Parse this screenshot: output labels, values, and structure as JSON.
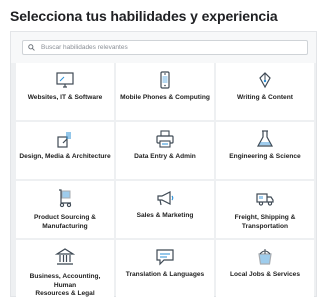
{
  "header": {
    "title": "Selecciona tus habilidades y experiencia"
  },
  "search": {
    "placeholder": "Buscar habilidades relevantes"
  },
  "categories": [
    {
      "label": "Websites, IT & Software",
      "icon": "monitor-icon"
    },
    {
      "label": "Mobile Phones & Computing",
      "icon": "mobile-phone-icon"
    },
    {
      "label": "Writing & Content",
      "icon": "pen-nib-icon"
    },
    {
      "label": "Design, Media & Architecture",
      "icon": "paint-palette-icon"
    },
    {
      "label": "Data Entry & Admin",
      "icon": "printer-icon"
    },
    {
      "label": "Engineering & Science",
      "icon": "flask-icon"
    },
    {
      "label": "Product Sourcing &\nManufacturing",
      "icon": "hand-truck-icon"
    },
    {
      "label": "Sales & Marketing",
      "icon": "megaphone-icon"
    },
    {
      "label": "Freight, Shipping &\nTransportation",
      "icon": "delivery-truck-icon"
    },
    {
      "label": "Business, Accounting, Human\nResources & Legal",
      "icon": "bank-building-icon"
    },
    {
      "label": "Translation & Languages",
      "icon": "speech-bubble-icon"
    },
    {
      "label": "Local Jobs & Services",
      "icon": "paint-bucket-icon"
    }
  ],
  "colors": {
    "icon_stroke": "#3f4a55",
    "icon_accent": "#2a8fd6"
  }
}
